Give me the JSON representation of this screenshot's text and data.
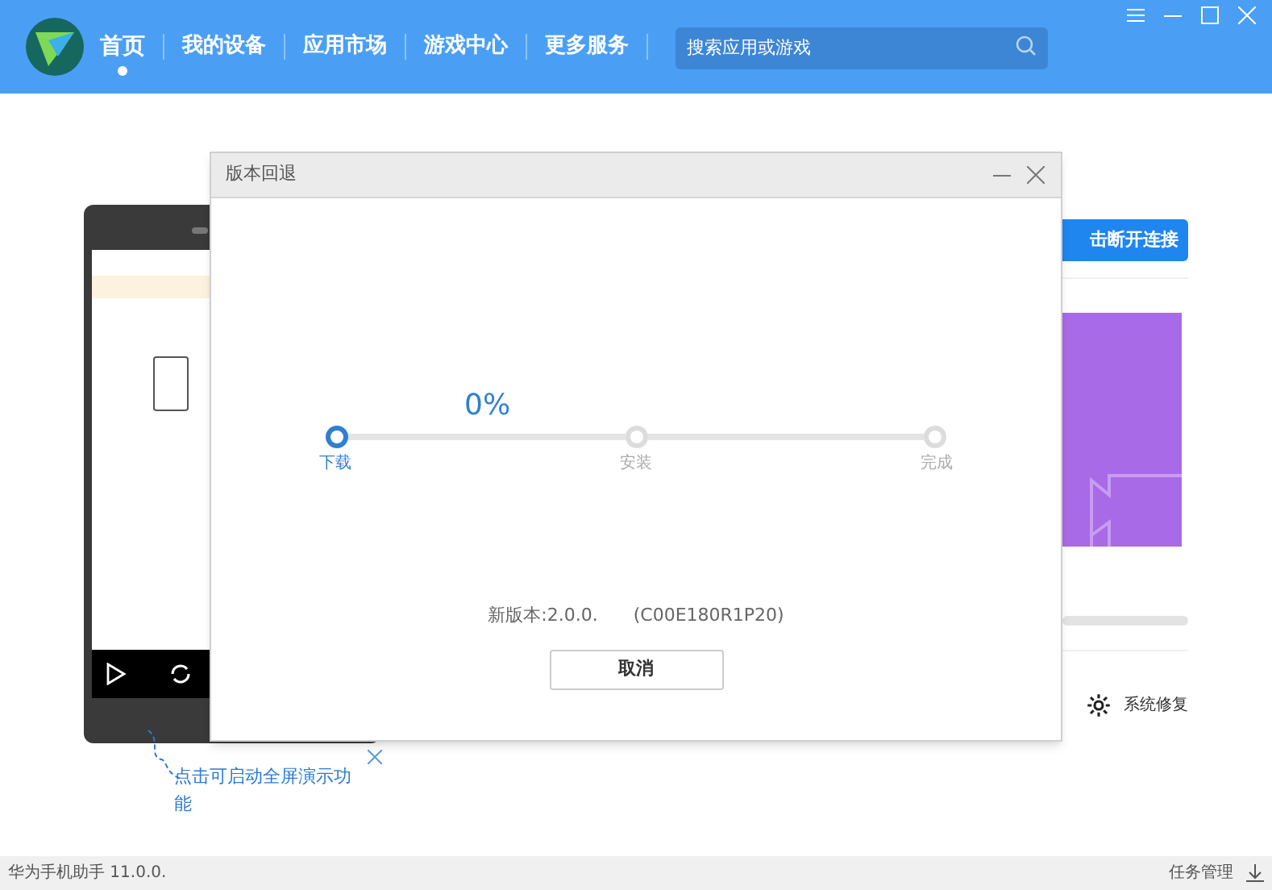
{
  "header": {
    "nav": [
      {
        "label": "首页",
        "selected": true
      },
      {
        "label": "我的设备",
        "selected": false
      },
      {
        "label": "应用市场",
        "selected": false
      },
      {
        "label": "游戏中心",
        "selected": false
      },
      {
        "label": "更多服务",
        "selected": false
      }
    ],
    "search": {
      "placeholder": "搜索应用或游戏"
    }
  },
  "main": {
    "connect_button": "击断开连接",
    "repair_label": "系统修复",
    "tip": {
      "text": "点击可启动全屏演示功能"
    }
  },
  "dialog": {
    "title": "版本回退",
    "progress": {
      "percent": "0%"
    },
    "steps": [
      {
        "label": "下载",
        "selected": true
      },
      {
        "label": "安装",
        "selected": false
      },
      {
        "label": "完成",
        "selected": false
      }
    ],
    "version": "新版本:2.0.0.",
    "version_suffix": "(C00E180R1P20)",
    "cancel": "取消"
  },
  "status_bar": {
    "app": "华为手机助手 11.0.0.",
    "tasks": "任务管理"
  }
}
